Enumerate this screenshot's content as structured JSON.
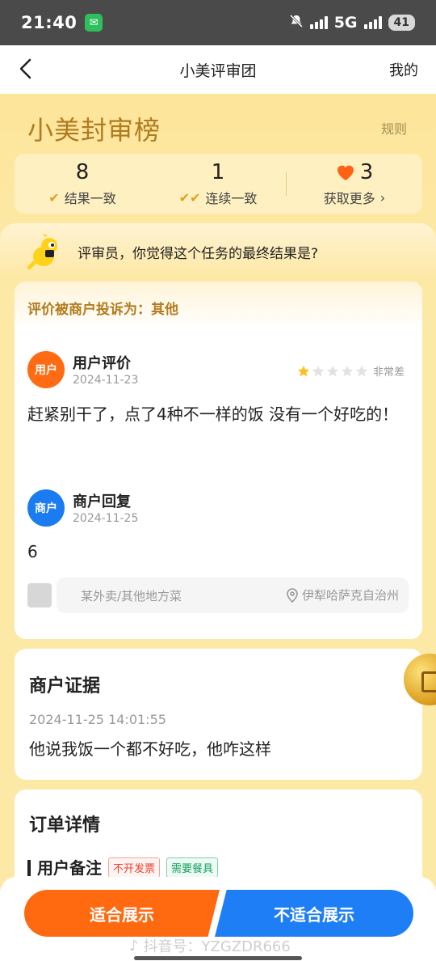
{
  "status_bar": {
    "time": "21:40",
    "network": "5G",
    "battery": "41"
  },
  "nav": {
    "title": "小美评审团",
    "mine": "我的"
  },
  "brand": {
    "title": "小美封审榜",
    "rules": "规则"
  },
  "stats": [
    {
      "value": "8",
      "label": "结果一致"
    },
    {
      "value": "1",
      "label": "连续一致"
    },
    {
      "value": "3",
      "label": "获取更多"
    }
  ],
  "question": "评审员，你觉得这个任务的最终结果是?",
  "review": {
    "complaint": "评价被商户投诉为：其他",
    "user": {
      "avatar": "用户",
      "name": "用户评价",
      "date": "2024-11-23",
      "stars": 1,
      "max_stars": 5,
      "rating_label": "非常差",
      "text": "赶紧别干了，点了4种不一样的饭 没有一个好吃的！"
    },
    "merchant": {
      "avatar": "商户",
      "name": "商户回复",
      "date": "2024-11-25",
      "text": "6"
    },
    "shop": "某外卖/其他地方菜",
    "location": "伊犁哈萨克自治州"
  },
  "evidence": {
    "title": "商户证据",
    "time": "2024-11-25 14:01:55",
    "text": "他说我饭一个都不好吃，他咋这样"
  },
  "order": {
    "title": "订单详情",
    "remark_label": "用户备注",
    "tags": [
      "不开发票",
      "需要餐具"
    ]
  },
  "actions": {
    "suitable": "适合展示",
    "unsuitable": "不适合展示"
  },
  "watermark": "抖音号：YZGZDR666",
  "colors": {
    "accent_orange": "#ff6a10",
    "accent_blue": "#1e7ef5",
    "brand_gold": "#b07a20"
  }
}
